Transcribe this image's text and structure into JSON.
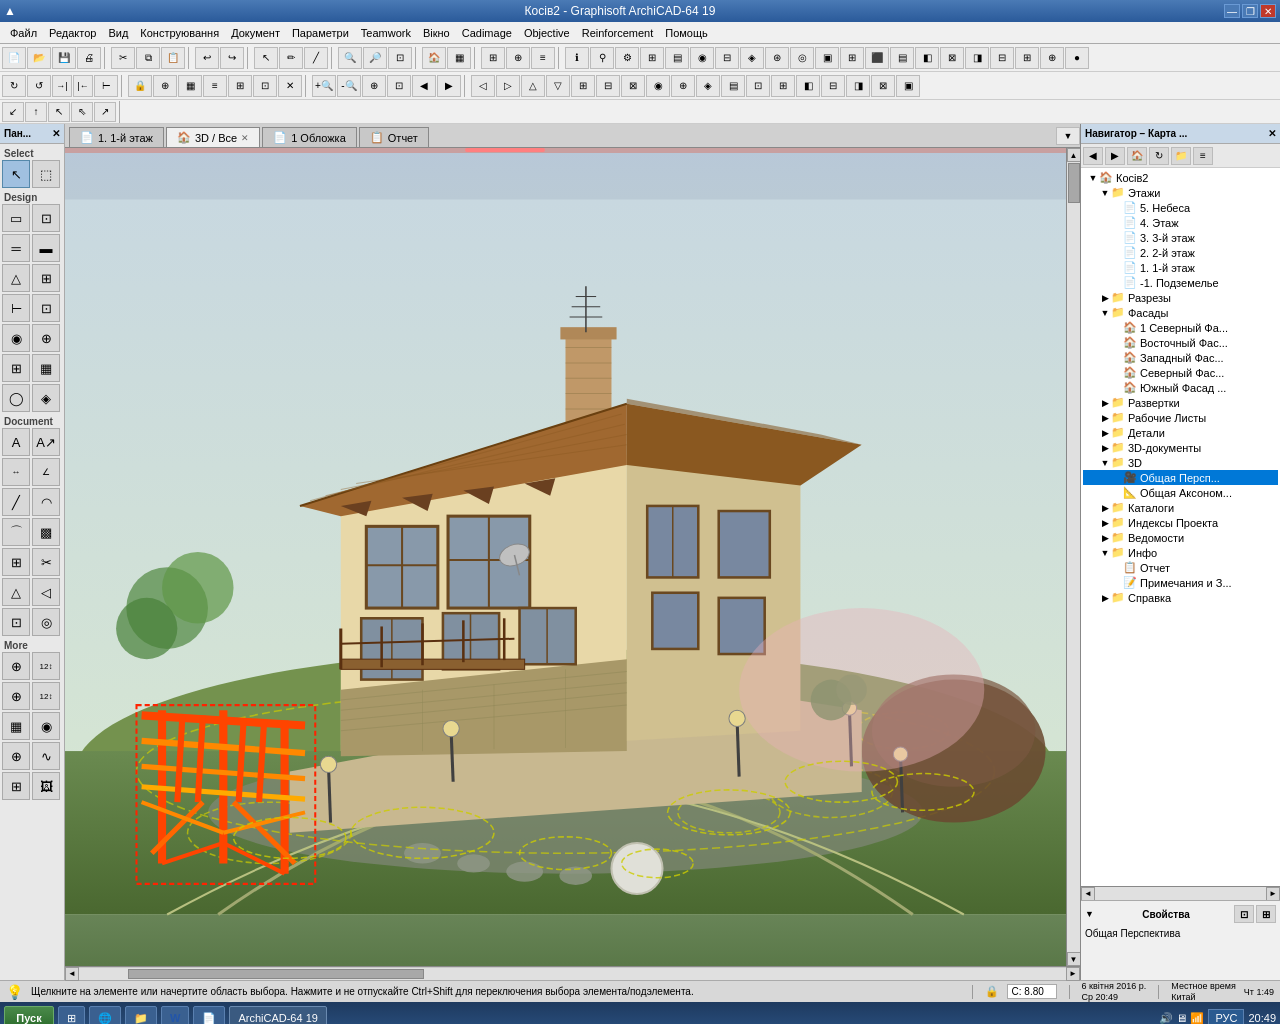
{
  "titlebar": {
    "title": "Косів2 - Graphisoft ArchiCAD-64 19",
    "icon": "●",
    "minimize": "—",
    "restore": "❐",
    "close": "✕"
  },
  "menubar": {
    "items": [
      "Файл",
      "Редактор",
      "Вид",
      "Конструювання",
      "Документ",
      "Параметри",
      "Teamwork",
      "Вікно",
      "Cadimage",
      "Objective",
      "Reinforcement",
      "Помощь"
    ]
  },
  "tabs": [
    {
      "id": "floor1",
      "icon": "📄",
      "label": "1. 1-й этаж",
      "closable": false,
      "active": false
    },
    {
      "id": "3d",
      "icon": "🏠",
      "label": "3D / Все",
      "closable": true,
      "active": true
    },
    {
      "id": "cover",
      "icon": "📄",
      "label": "1 Обложка",
      "closable": false,
      "active": false
    },
    {
      "id": "report",
      "icon": "📋",
      "label": "Отчет",
      "closable": false,
      "active": false
    }
  ],
  "left_panel": {
    "title": "Пан...",
    "close_btn": "✕",
    "select_label": "Select",
    "more_label": "More",
    "design_label": "Design",
    "document_label": "Document"
  },
  "navigator": {
    "title": "Навигатор – Карта ...",
    "close_btn": "✕",
    "tree": [
      {
        "id": "root",
        "label": "Косів2",
        "level": 0,
        "icon": "🏠",
        "expanded": true
      },
      {
        "id": "floors",
        "label": "Этажи",
        "level": 1,
        "icon": "📁",
        "expanded": true
      },
      {
        "id": "floor5",
        "label": "5. Небеса",
        "level": 2,
        "icon": "📄"
      },
      {
        "id": "floor4",
        "label": "4. Этаж",
        "level": 2,
        "icon": "📄"
      },
      {
        "id": "floor3",
        "label": "3. 3-й этаж",
        "level": 2,
        "icon": "📄"
      },
      {
        "id": "floor2",
        "label": "2. 2-й этаж",
        "level": 2,
        "icon": "📄"
      },
      {
        "id": "floor1",
        "label": "1. 1-й этаж",
        "level": 2,
        "icon": "📄"
      },
      {
        "id": "floor-1",
        "label": "-1. Подземелье",
        "level": 2,
        "icon": "📄"
      },
      {
        "id": "sections",
        "label": "Разрезы",
        "level": 1,
        "icon": "📁"
      },
      {
        "id": "facades",
        "label": "Фасады",
        "level": 1,
        "icon": "📁",
        "expanded": true
      },
      {
        "id": "f1",
        "label": "1 Северный Фа...",
        "level": 2,
        "icon": "🏠"
      },
      {
        "id": "f2",
        "label": "Восточный Фас...",
        "level": 2,
        "icon": "🏠"
      },
      {
        "id": "f3",
        "label": "Западный Фас...",
        "level": 2,
        "icon": "🏠"
      },
      {
        "id": "f4",
        "label": "Северный Фас...",
        "level": 2,
        "icon": "🏠"
      },
      {
        "id": "f5",
        "label": "Южный Фасад ...",
        "level": 2,
        "icon": "🏠"
      },
      {
        "id": "developments",
        "label": "Развертки",
        "level": 1,
        "icon": "📁"
      },
      {
        "id": "worksheets",
        "label": "Рабочие Листы",
        "level": 1,
        "icon": "📁"
      },
      {
        "id": "details",
        "label": "Детали",
        "level": 1,
        "icon": "📁"
      },
      {
        "id": "3ddocs",
        "label": "3D-документы",
        "level": 1,
        "icon": "📁"
      },
      {
        "id": "3d",
        "label": "3D",
        "level": 1,
        "icon": "📁",
        "expanded": true
      },
      {
        "id": "3d_persp",
        "label": "Общая Персп...",
        "level": 2,
        "icon": "🎥",
        "selected": true
      },
      {
        "id": "3d_axon",
        "label": "Общая Аксоном...",
        "level": 2,
        "icon": "📐"
      },
      {
        "id": "catalogs",
        "label": "Каталоги",
        "level": 1,
        "icon": "📁"
      },
      {
        "id": "indexes",
        "label": "Индексы Проекта",
        "level": 1,
        "icon": "📁"
      },
      {
        "id": "records",
        "label": "Ведомости",
        "level": 1,
        "icon": "📁"
      },
      {
        "id": "info",
        "label": "Инфо",
        "level": 1,
        "icon": "📁",
        "expanded": true
      },
      {
        "id": "report",
        "label": "Отчет",
        "level": 2,
        "icon": "📋"
      },
      {
        "id": "notes",
        "label": "Примечания и З...",
        "level": 2,
        "icon": "📝"
      },
      {
        "id": "help",
        "label": "Справка",
        "level": 1,
        "icon": "📁"
      }
    ]
  },
  "properties": {
    "header": "Свойства",
    "label": "Общая Перспектива"
  },
  "status_bar": {
    "message": "Щелкните на элементе или начертите область выбора. Нажмите и не отпускайте Ctrl+Shift для переключения выбора элемента/подэлемента.",
    "coord_c": "C: 8.80",
    "date": "6 квітня 2016 р.",
    "local_time_label": "Местное время",
    "time": "Ср 20:49",
    "country": "Китай",
    "day_time": "Чт 1:49"
  },
  "taskbar": {
    "start": "Пуск",
    "apps": [
      "⊞",
      "🌐",
      "📁",
      "W",
      "📄"
    ],
    "lang": "РУС",
    "time": "20:49"
  }
}
